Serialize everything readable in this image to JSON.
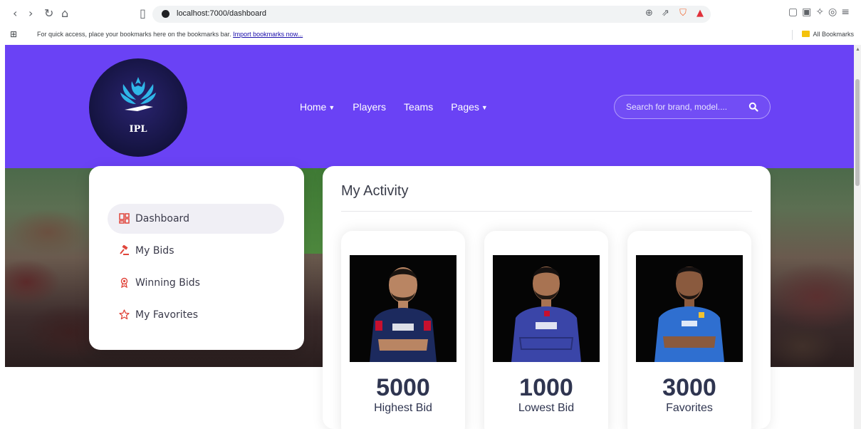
{
  "browser": {
    "url": "localhost:7000/dashboard",
    "bookmarks_message": "For quick access, place your bookmarks here on the bookmarks bar.",
    "import_link": "Import bookmarks now...",
    "all_bookmarks": "All Bookmarks"
  },
  "header": {
    "logo_text": "IPL",
    "menu": [
      {
        "label": "Home",
        "has_dropdown": true
      },
      {
        "label": "Players",
        "has_dropdown": false
      },
      {
        "label": "Teams",
        "has_dropdown": false
      },
      {
        "label": "Pages",
        "has_dropdown": true
      }
    ],
    "search_placeholder": "Search for brand, model...."
  },
  "sidebar": {
    "items": [
      {
        "label": "Dashboard",
        "icon": "dashboard-icon",
        "active": true
      },
      {
        "label": "My Bids",
        "icon": "gavel-icon",
        "active": false
      },
      {
        "label": "Winning Bids",
        "icon": "award-icon",
        "active": false
      },
      {
        "label": "My Favorites",
        "icon": "star-icon",
        "active": false
      }
    ]
  },
  "activity": {
    "title": "My Activity",
    "cards": [
      {
        "value": "5000",
        "caption": "Highest Bid",
        "jersey_color": "#1c2a5e",
        "accent": "#c8102e"
      },
      {
        "value": "1000",
        "caption": "Lowest Bid",
        "jersey_color": "#3a45a8",
        "accent": "#c8102e"
      },
      {
        "value": "3000",
        "caption": "Favorites",
        "jersey_color": "#2f6fd0",
        "accent": "#f2c230"
      }
    ]
  },
  "colors": {
    "header_bg": "#6a42f5",
    "accent_icon": "#e0463c"
  }
}
